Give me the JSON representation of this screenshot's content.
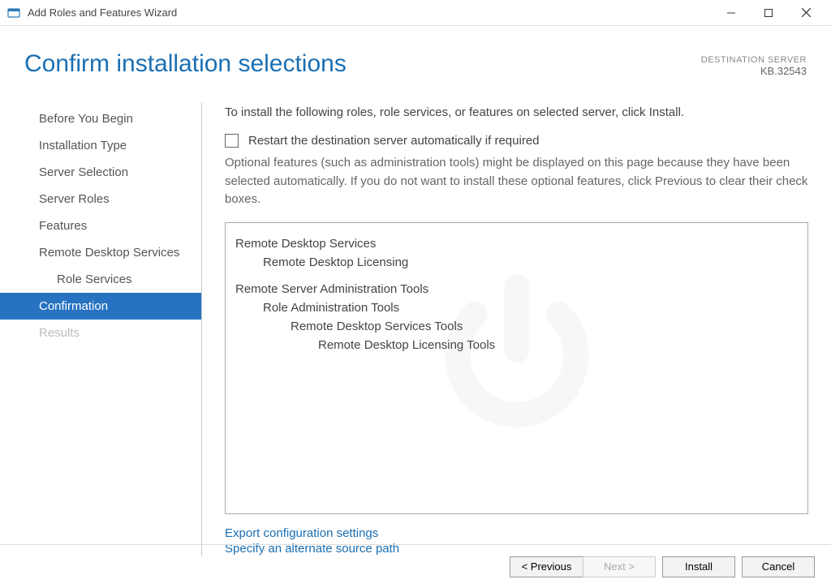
{
  "window": {
    "title": "Add Roles and Features Wizard"
  },
  "header": {
    "page_title": "Confirm installation selections",
    "dest_label": "DESTINATION SERVER",
    "dest_value": "KB.32543"
  },
  "sidebar": {
    "items": [
      {
        "label": "Before You Begin",
        "indent": false,
        "active": false,
        "disabled": false
      },
      {
        "label": "Installation Type",
        "indent": false,
        "active": false,
        "disabled": false
      },
      {
        "label": "Server Selection",
        "indent": false,
        "active": false,
        "disabled": false
      },
      {
        "label": "Server Roles",
        "indent": false,
        "active": false,
        "disabled": false
      },
      {
        "label": "Features",
        "indent": false,
        "active": false,
        "disabled": false
      },
      {
        "label": "Remote Desktop Services",
        "indent": false,
        "active": false,
        "disabled": false
      },
      {
        "label": "Role Services",
        "indent": true,
        "active": false,
        "disabled": false
      },
      {
        "label": "Confirmation",
        "indent": false,
        "active": true,
        "disabled": false
      },
      {
        "label": "Results",
        "indent": false,
        "active": false,
        "disabled": true
      }
    ]
  },
  "main": {
    "intro": "To install the following roles, role services, or features on selected server, click Install.",
    "restart_label": "Restart the destination server automatically if required",
    "restart_checked": false,
    "optional_note": "Optional features (such as administration tools) might be displayed on this page because they have been selected automatically. If you do not want to install these optional features, click Previous to clear their check boxes.",
    "selections": [
      {
        "label": "Remote Desktop Services",
        "level": 1
      },
      {
        "label": "Remote Desktop Licensing",
        "level": 2
      },
      {
        "label": "Remote Server Administration Tools",
        "level": 1,
        "newgroup": true
      },
      {
        "label": "Role Administration Tools",
        "level": 2
      },
      {
        "label": "Remote Desktop Services Tools",
        "level": 3
      },
      {
        "label": "Remote Desktop Licensing Tools",
        "level": 4
      }
    ],
    "links": {
      "export": "Export configuration settings",
      "alt_source": "Specify an alternate source path"
    }
  },
  "buttons": {
    "previous": "< Previous",
    "next": "Next >",
    "install": "Install",
    "cancel": "Cancel"
  }
}
